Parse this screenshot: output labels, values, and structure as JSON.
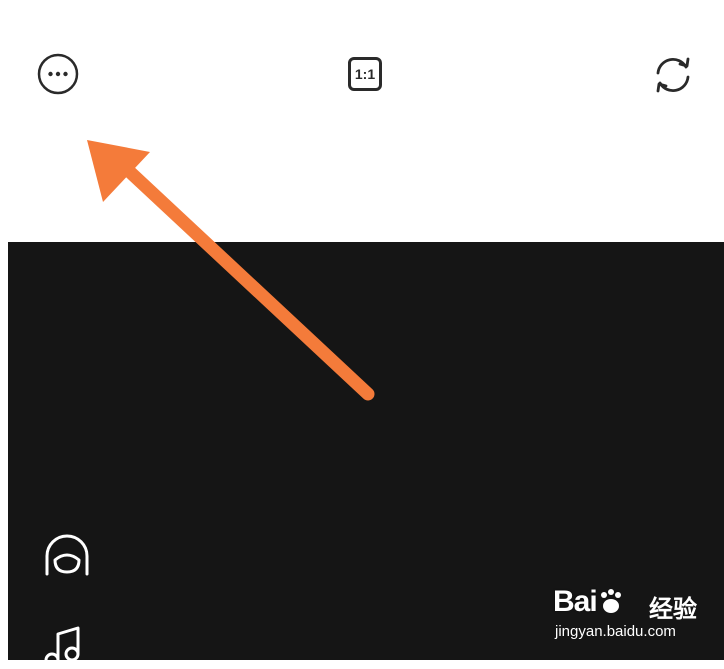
{
  "toolbar": {
    "more_icon": "more-icon",
    "aspect_ratio_label": "1:1",
    "flip_icon": "flip-camera-icon"
  },
  "side_tools": {
    "filter_icon": "filter-face-icon",
    "music_icon": "music-icon"
  },
  "annotation": {
    "arrow_color": "#f47b3a"
  },
  "watermark": {
    "brand": "Bai",
    "brand_suffix": "du",
    "chinese": "经验",
    "url": "jingyan.baidu.com"
  },
  "colors": {
    "viewfinder_bg": "#151515",
    "toolbar_bg": "#ffffff",
    "icon_dark": "#2a2a2a"
  }
}
